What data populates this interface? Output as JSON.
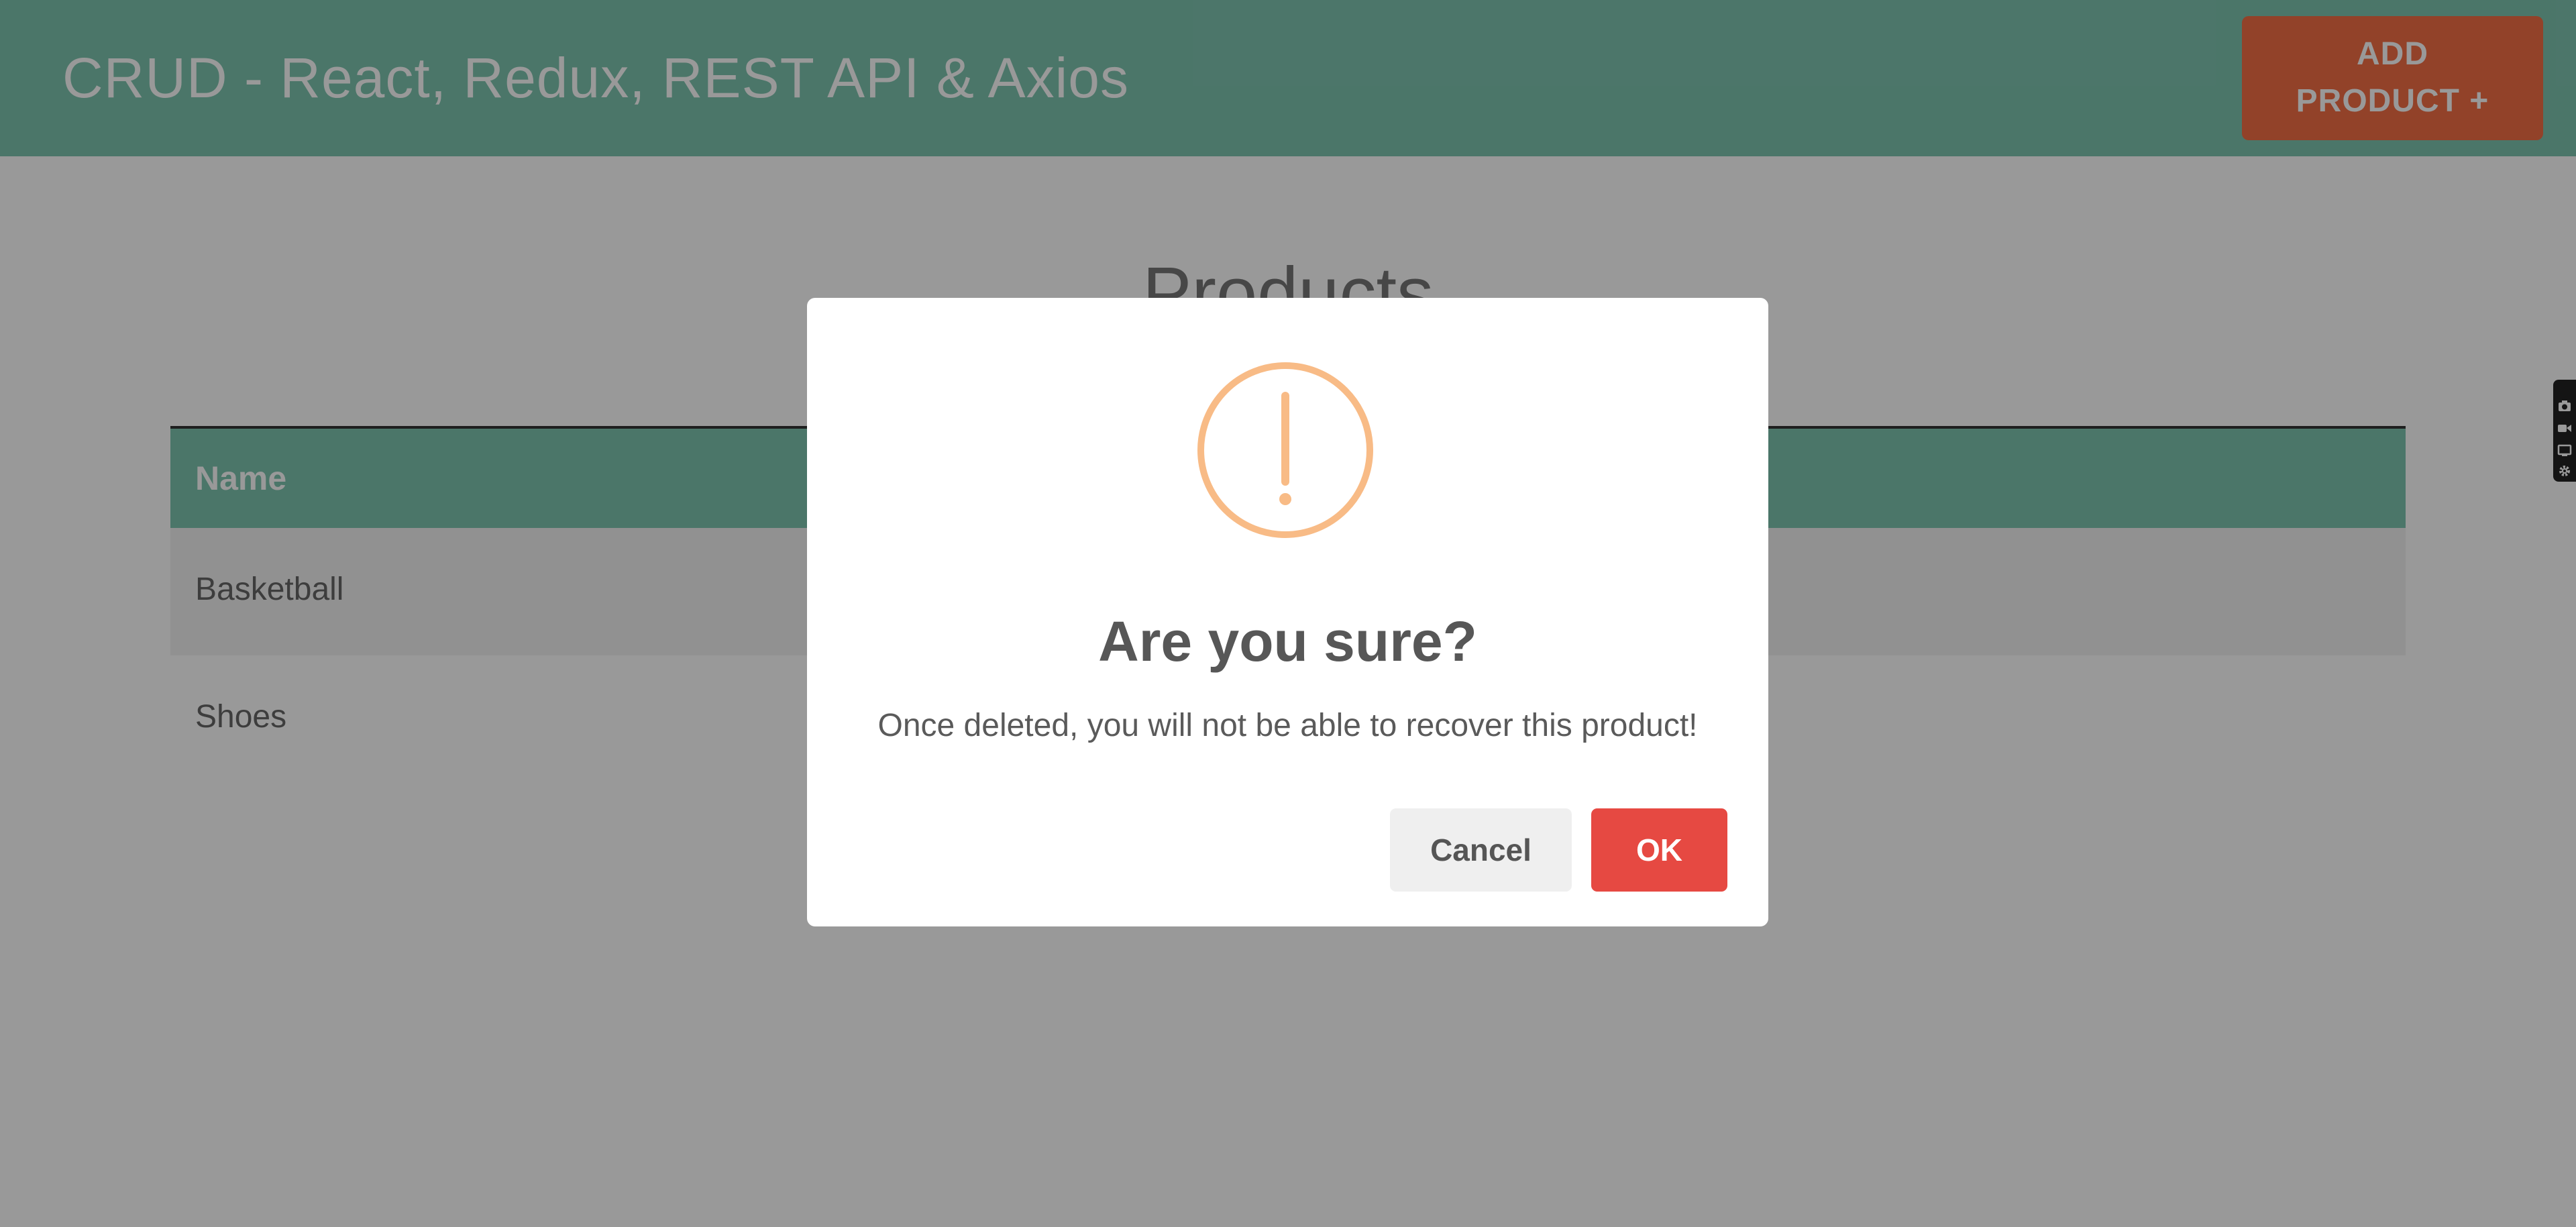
{
  "header": {
    "title": "CRUD - React, Redux, REST API & Axios",
    "add_button_line1": "ADD",
    "add_button_line2": "PRODUCT +"
  },
  "main": {
    "title": "Products",
    "table": {
      "columns": [
        "Name"
      ],
      "rows": [
        {
          "name": "Basketball"
        },
        {
          "name": "Shoes"
        }
      ]
    }
  },
  "dialog": {
    "icon": "warning-exclamation-icon",
    "title": "Are you sure?",
    "text": "Once deleted, you will not be able to recover this product!",
    "cancel_label": "Cancel",
    "ok_label": "OK"
  },
  "side_toolbar": {
    "icons": [
      "camera-icon",
      "video-icon",
      "screen-icon",
      "gear-icon"
    ]
  },
  "colors": {
    "header_bg": "#7ec5b0",
    "add_button": "#f46e45",
    "warning": "#f8bb86",
    "ok_button": "#e64942",
    "cancel_button": "#efefef"
  }
}
